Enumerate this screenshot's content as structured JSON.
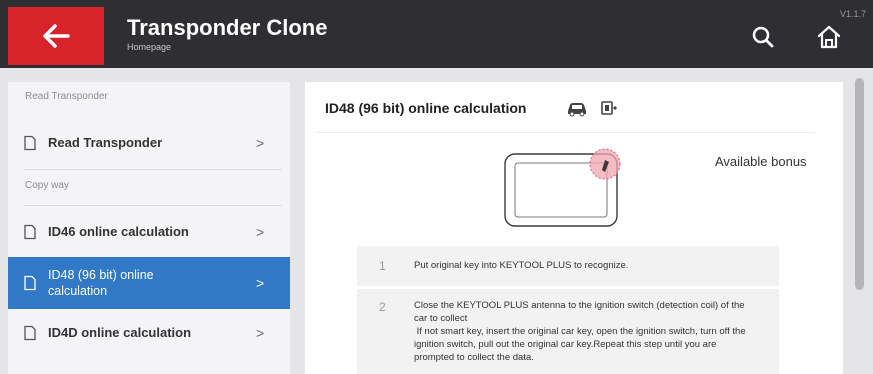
{
  "header": {
    "title": "Transponder Clone",
    "subtitle": "Homepage",
    "version": "V1.1.7",
    "back_icon": "arrow-left-icon",
    "search_icon": "search-icon",
    "home_icon": "home-icon"
  },
  "sidebar": {
    "sections": [
      {
        "label": "Read Transponder"
      },
      {
        "label": "Copy way"
      }
    ],
    "items": [
      {
        "label": "Read Transponder",
        "chevron": ">",
        "active": false
      },
      {
        "label": "ID46 online calculation",
        "chevron": ">",
        "active": false
      },
      {
        "label": "ID48 (96 bit) online calculation",
        "chevron": ">",
        "active": true
      },
      {
        "label": "ID4D online calculation",
        "chevron": ">",
        "active": false
      }
    ]
  },
  "main": {
    "title": "ID48 (96 bit) online calculation",
    "bonus_label": "Available bonus",
    "steps": [
      {
        "number": "1",
        "text": "Put original key into KEYTOOL PLUS to recognize."
      },
      {
        "number": "2",
        "text": "Close the KEYTOOL PLUS antenna to the ignition switch (detection coil) of the car to collect\n If not smart key, insert the original car key, open the ignition switch, turn off the ignition switch, pull out the original car key.Repeat this step until you are prompted to collect the data."
      }
    ]
  },
  "colors": {
    "topbar": "#2f2f33",
    "accent_red": "#d9232a",
    "active_blue": "#3178c6",
    "background": "#e5e5e8"
  }
}
